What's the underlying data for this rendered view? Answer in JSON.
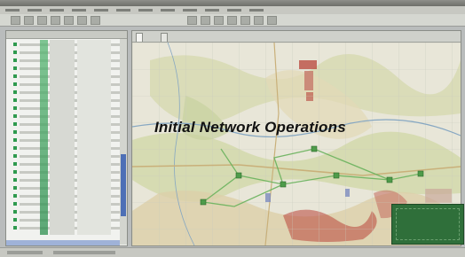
{
  "window": {
    "menu_count": 12,
    "toolbar_count": 14
  },
  "left_panel": {
    "rows": 24
  },
  "map_panel": {
    "tabs": [
      "",
      ""
    ]
  },
  "overlay": {
    "title": "Initial Network Operations"
  },
  "colors": {
    "accent_green": "#2f9a4e",
    "scroll_blue": "#4d6fb6",
    "inset_green": "#2f6f3a",
    "terrain_red": "#b8443a"
  },
  "icons": [
    "menu-icon",
    "toolbar-icon",
    "tree-node-icon"
  ]
}
